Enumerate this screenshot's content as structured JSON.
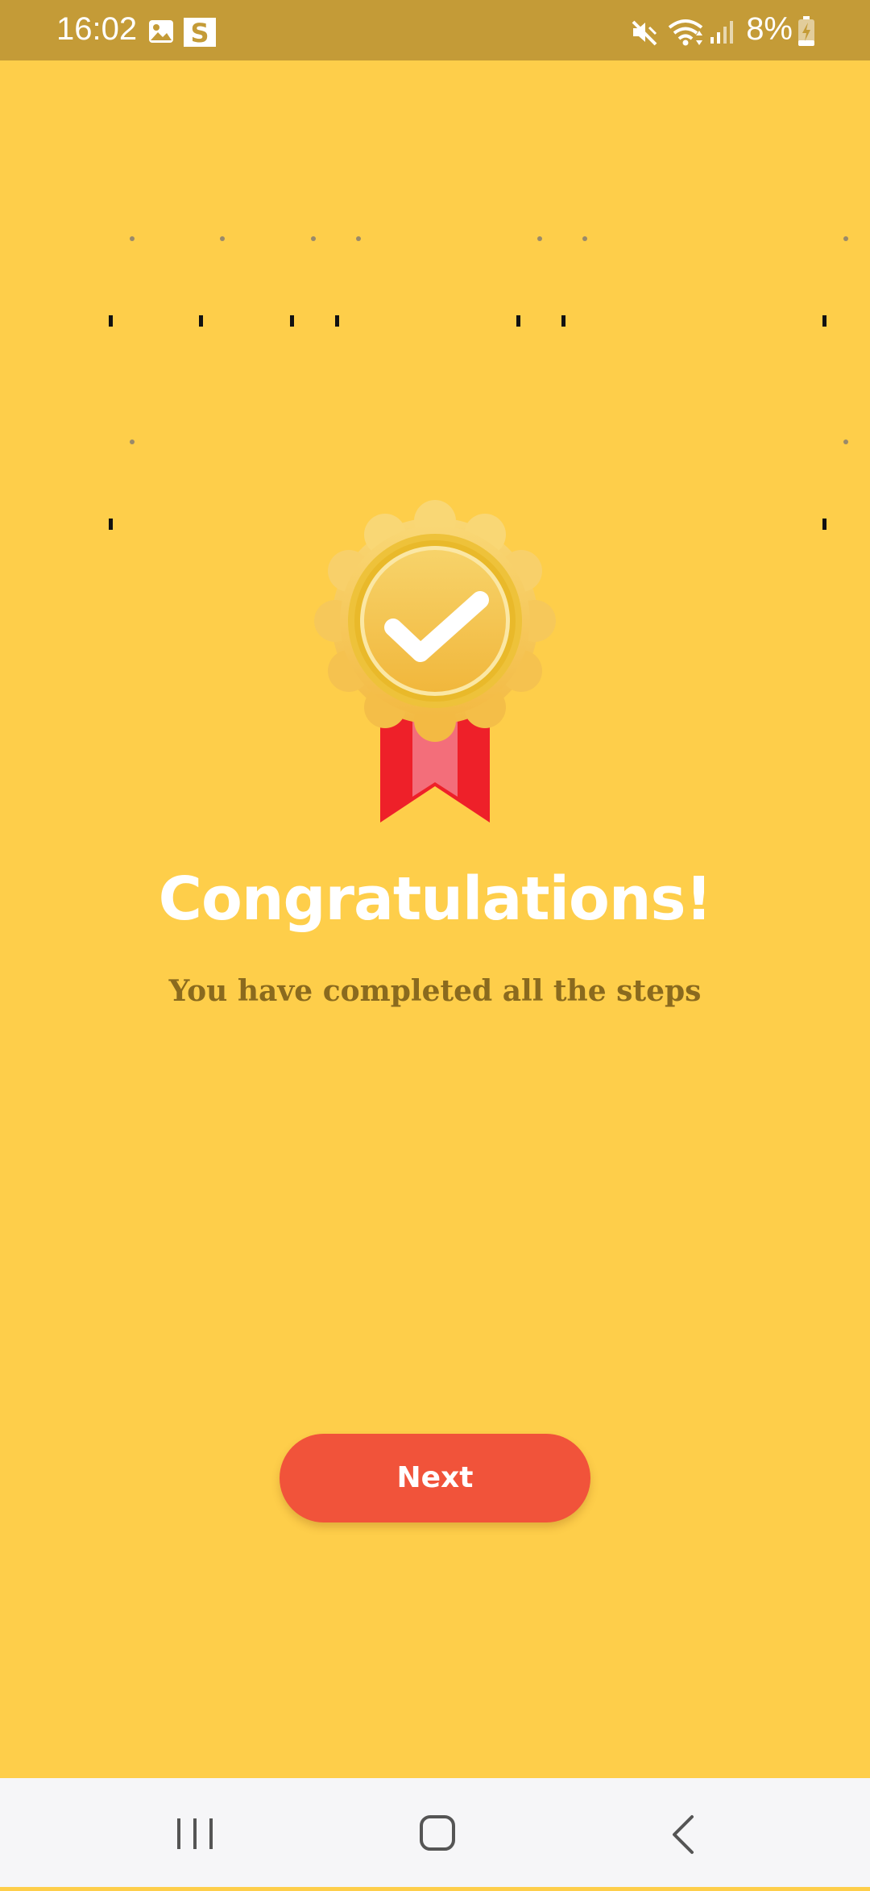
{
  "status_bar": {
    "time": "16:02",
    "battery_percent": "8%",
    "icons": [
      "gallery-icon",
      "s-app-icon",
      "mute-icon",
      "wifi-icon",
      "signal-icon",
      "battery-charging-icon"
    ],
    "background": "#C49B37"
  },
  "content": {
    "medal_icon": "award-badge-check-icon",
    "title": "Congratulations!",
    "subtitle": "You have completed all the steps",
    "next_label": "Next",
    "colors": {
      "background": "#FECE4A",
      "button": "#F1533A",
      "title": "#FFFFFF",
      "subtitle": "#8A6A1E",
      "ribbon": "#EE2029"
    }
  },
  "nav_bar": {
    "icons": [
      "recent-apps-icon",
      "home-icon",
      "back-icon"
    ]
  }
}
